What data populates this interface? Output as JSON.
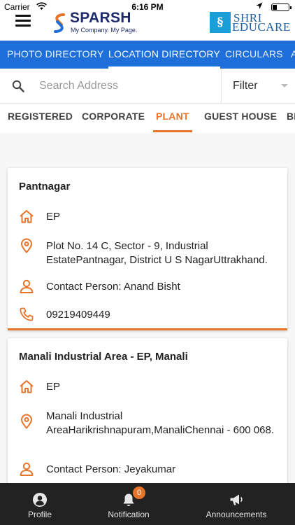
{
  "status_bar": {
    "carrier": "Carrier",
    "time": "6:16 PM"
  },
  "header": {
    "brand_name": "SPARSH",
    "brand_tagline": "My Company. My Page.",
    "partner_line1": "SHRI",
    "partner_line2": "EDUCARE"
  },
  "top_tabs": [
    {
      "label": "PHOTO DIRECTORY"
    },
    {
      "label": "LOCATION DIRECTORY"
    },
    {
      "label": "CIRCULARS"
    },
    {
      "label": "A"
    }
  ],
  "search": {
    "placeholder": "Search Address",
    "value": ""
  },
  "filter": {
    "label": "Filter"
  },
  "category_tabs": [
    {
      "label": "REGISTERED"
    },
    {
      "label": "CORPORATE"
    },
    {
      "label": "PLANT"
    },
    {
      "label": "GUEST HOUSE"
    },
    {
      "label": "BI"
    }
  ],
  "cards": [
    {
      "title": "Pantnagar",
      "company": "EP",
      "address": "Plot No. 14 C, Sector - 9, Industrial EstatePantnagar, District U S NagarUttrakhand.",
      "contact": "Contact Person: Anand Bisht",
      "phone": "09219409449"
    },
    {
      "title": "Manali Industrial Area - EP, Manali",
      "company": "EP",
      "address": "Manali Industrial AreaHarikrishnapuram,ManaliChennai - 600 068.",
      "contact": "Contact Person: Jeyakumar"
    }
  ],
  "bottom_nav": {
    "profile": "Profile",
    "notification": "Notification",
    "notification_count": "0",
    "announcements": "Announcements"
  },
  "colors": {
    "accent": "#e8742a",
    "primary": "#1e6fd9",
    "nav_bg": "#222222"
  },
  "icons": [
    "menu-icon",
    "search-icon",
    "home-icon",
    "location-pin-icon",
    "person-icon",
    "phone-icon",
    "profile-icon",
    "bell-icon",
    "megaphone-icon"
  ]
}
